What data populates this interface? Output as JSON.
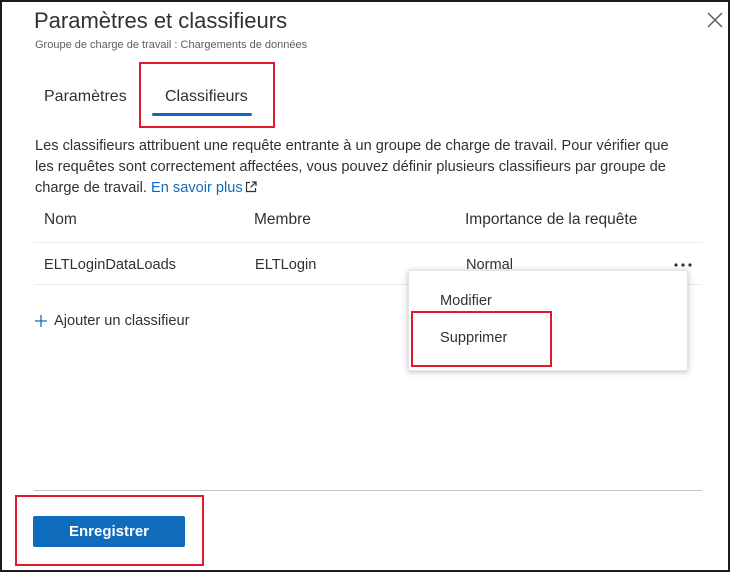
{
  "header": {
    "title": "Paramètres et classifieurs",
    "subtitle": "Groupe de charge de travail : Chargements de données"
  },
  "tabs": [
    {
      "label": "Paramètres",
      "selected": false
    },
    {
      "label": "Classifieurs",
      "selected": true
    }
  ],
  "description": {
    "text": "Les classifieurs attribuent une requête entrante à un groupe de charge de travail. Pour vérifier que les requêtes sont correctement affectées, vous pouvez définir plusieurs classifieurs par groupe de charge de travail.",
    "link_label": "En savoir plus"
  },
  "table": {
    "columns": [
      "Nom",
      "Membre",
      "Importance de la requête"
    ],
    "rows": [
      {
        "name": "ELTLoginDataLoads",
        "member": "ELTLogin",
        "importance": "Normal"
      }
    ]
  },
  "add_classifier_label": "Ajouter un classifieur",
  "context_menu": {
    "items": [
      "Modifier",
      "Supprimer"
    ]
  },
  "footer": {
    "save_label": "Enregistrer"
  },
  "colors": {
    "accent": "#0f6cbd",
    "highlight": "#e01a2b"
  },
  "icons": [
    "close-icon",
    "external-link-icon",
    "more-icon",
    "plus-icon"
  ]
}
